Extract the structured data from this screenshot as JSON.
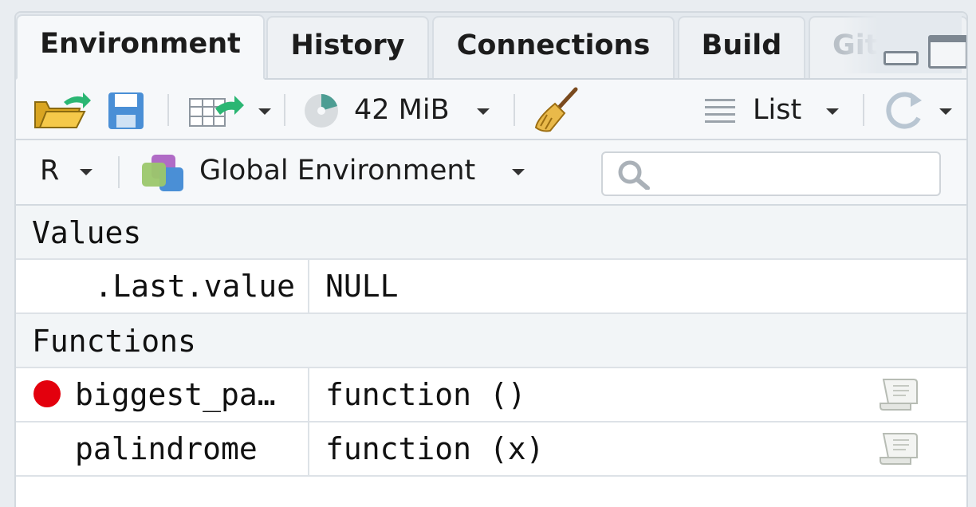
{
  "tabs": [
    "Environment",
    "History",
    "Connections",
    "Build",
    "Git"
  ],
  "active_tab": "Environment",
  "toolbar": {
    "memory_label": "42 MiB",
    "view_mode_label": "List"
  },
  "env_bar": {
    "language_label": "R",
    "environment_label": "Global Environment",
    "search_placeholder": ""
  },
  "sections": {
    "values_header": "Values",
    "functions_header": "Functions"
  },
  "values": [
    {
      "name": ".Last.value",
      "value": "NULL"
    }
  ],
  "functions": [
    {
      "name": "biggest_pa…",
      "value": "function ()",
      "breakpoint": true
    },
    {
      "name": "palindrome",
      "value": "function (x)",
      "breakpoint": false
    }
  ],
  "colors": {
    "breakpoint": "#e3000d",
    "accent_green": "#2bb673",
    "folder_yellow": "#f2c14e",
    "save_blue": "#4a8fd6"
  }
}
